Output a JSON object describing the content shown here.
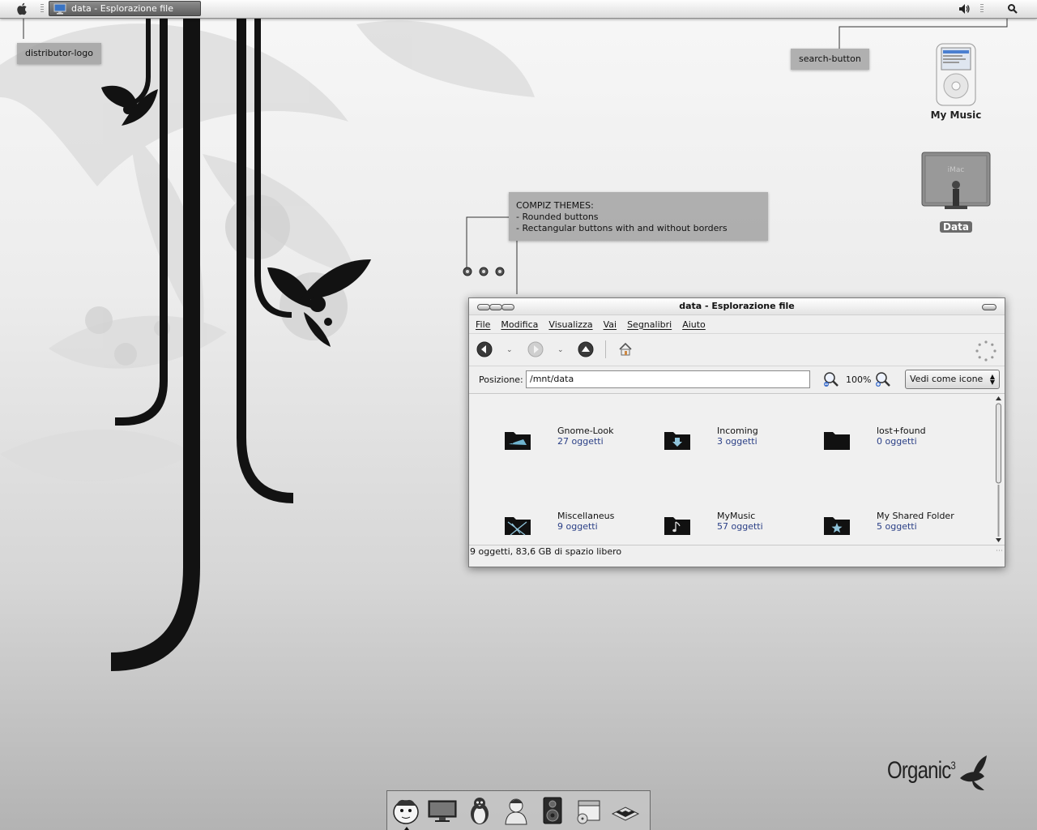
{
  "top_panel": {
    "task_title": "data - Esplorazione file"
  },
  "callouts": {
    "distributor_logo": "distributor-logo",
    "search_button": "search-button",
    "compiz": {
      "title": "COMPIZ THEMES:",
      "line1": "- Rounded buttons",
      "line2": "- Rectangular buttons with and without borders"
    }
  },
  "desktop": {
    "my_music": "My Music",
    "data": "Data",
    "imac_brand": "iMac",
    "wallpaper_brand": "Organic",
    "wallpaper_brand_sup": "3"
  },
  "window": {
    "title": "data - Esplorazione file",
    "menu": [
      "File",
      "Modifica",
      "Visualizza",
      "Vai",
      "Segnalibri",
      "Aiuto"
    ],
    "location_label": "Posizione:",
    "location_value": "/mnt/data",
    "zoom": "100%",
    "view_mode": "Vedi come icone",
    "items": [
      {
        "name": "Gnome-Look",
        "count": "27 oggetti",
        "icon": "gnome-folder-icon"
      },
      {
        "name": "Incoming",
        "count": "3 oggetti",
        "icon": "download-folder-icon"
      },
      {
        "name": "lost+found",
        "count": "0 oggetti",
        "icon": "folder-icon"
      },
      {
        "name": "Miscellaneus",
        "count": "9 oggetti",
        "icon": "misc-folder-icon"
      },
      {
        "name": "MyMusic",
        "count": "57 oggetti",
        "icon": "music-folder-icon"
      },
      {
        "name": "My Shared Folder",
        "count": "5 oggetti",
        "icon": "shared-folder-icon"
      }
    ],
    "status": "9 oggetti, 83,6 GB di spazio libero"
  },
  "dock": {
    "icons": [
      "face-icon",
      "monitor-icon",
      "penguin-icon",
      "person-icon",
      "speaker-icon",
      "install-icon",
      "chess-icon"
    ]
  },
  "colors": {
    "count_text": "#2a3f86",
    "folder": "#111111",
    "callout": "#969696"
  }
}
